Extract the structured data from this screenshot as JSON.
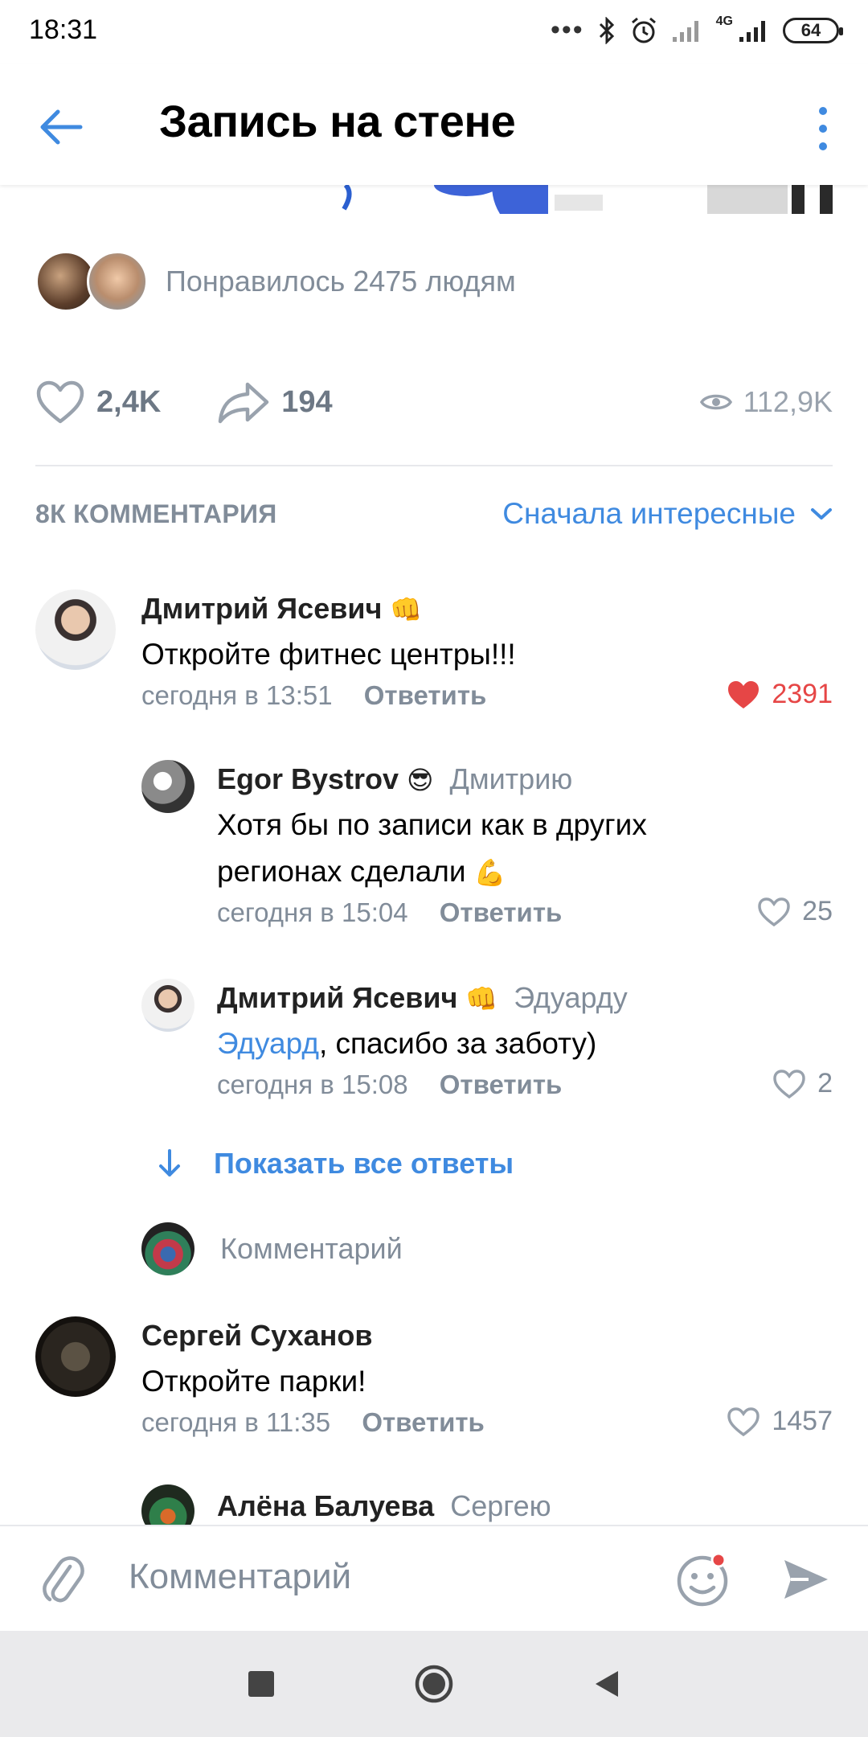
{
  "status_bar": {
    "time": "18:31",
    "battery": "64",
    "network": "4G"
  },
  "header": {
    "title": "Запись на стене"
  },
  "likers": {
    "text": "Понравилось 2475 людям"
  },
  "actions": {
    "likes": "2,4K",
    "shares": "194",
    "views": "112,9K"
  },
  "comments_header": {
    "count": "8К КОММЕНТАРИЯ",
    "sort": "Сначала интересные"
  },
  "comments": [
    {
      "author": "Дмитрий Ясевич",
      "author_emoji": "👊",
      "text": "Откройте фитнес центры!!!",
      "time": "сегодня в 13:51",
      "reply_label": "Ответить",
      "likes": "2391",
      "liked": true
    },
    {
      "author": "Egor Bystrov",
      "author_emoji": "😎",
      "reply_to": "Дмитрию",
      "text_line1": "Хотя бы по записи как в других",
      "text_line2": "регионах сделали",
      "text_emoji": "💪",
      "time": "сегодня в 15:04",
      "reply_label": "Ответить",
      "likes": "25"
    },
    {
      "author": "Дмитрий Ясевич",
      "author_emoji": "👊",
      "reply_to": "Эдуарду",
      "mention": "Эдуард",
      "text": ", спасибо за заботу)",
      "time": "сегодня в 15:08",
      "reply_label": "Ответить",
      "likes": "2"
    },
    {
      "author": "Сергей Суханов",
      "text": "Откройте парки!",
      "time": "сегодня в 11:35",
      "reply_label": "Ответить",
      "likes": "1457"
    },
    {
      "author": "Алёна Балуева",
      "reply_to": "Сергею"
    }
  ],
  "show_all_replies": "Показать все ответы",
  "inline_comment_placeholder": "Комментарий",
  "composer": {
    "placeholder": "Комментарий"
  },
  "colors": {
    "accent": "#3f8ae0",
    "liked": "#e64646",
    "secondary_text": "#818c99"
  }
}
